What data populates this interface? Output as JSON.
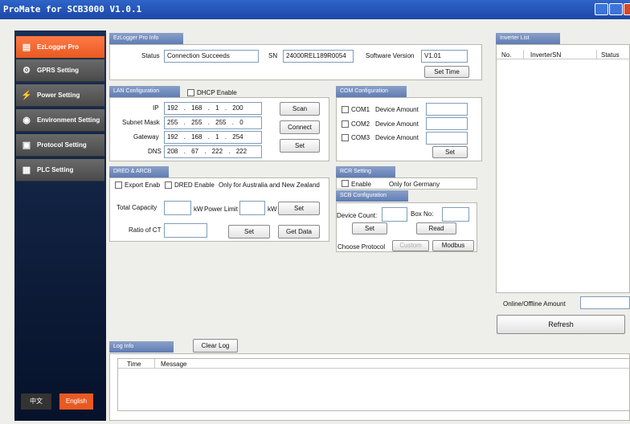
{
  "window": {
    "title": "ProMate for SCB3000 V1.0.1"
  },
  "sidebar": {
    "items": [
      {
        "label": "EzLogger Pro",
        "icon": "doc-box-icon"
      },
      {
        "label": "GPRS Setting",
        "icon": "gear-icon"
      },
      {
        "label": "Power Setting",
        "icon": "plug-icon"
      },
      {
        "label": "Environment Setting",
        "icon": "globe-icon"
      },
      {
        "label": "Protocol Setting",
        "icon": "file-icon"
      },
      {
        "label": "PLC Setting",
        "icon": "chip-icon"
      }
    ],
    "lang_cn": "中文",
    "lang_en": "English"
  },
  "info": {
    "tab": "EzLogger Pro Info",
    "status_label": "Status",
    "status_value": "Connection Succeeds",
    "sn_label": "SN",
    "sn_value": "24000REL189R0054",
    "sw_label": "Software Version",
    "sw_value": "V1.01",
    "set_time": "Set Time"
  },
  "lan": {
    "tab": "LAN Configuration",
    "dhcp": "DHCP Enable",
    "ip_label": "IP",
    "ip": [
      "192",
      "168",
      "1",
      "200"
    ],
    "mask_label": "Subnet Mask",
    "mask": [
      "255",
      "255",
      "255",
      "0"
    ],
    "gw_label": "Gateway",
    "gw": [
      "192",
      "168",
      "1",
      "254"
    ],
    "dns_label": "DNS",
    "dns": [
      "208",
      "67",
      "222",
      "222"
    ],
    "scan": "Scan",
    "connect": "Connect",
    "set": "Set"
  },
  "com": {
    "tab": "COM Configuration",
    "rows": [
      {
        "port": "COM1",
        "label": "Device Amount"
      },
      {
        "port": "COM2",
        "label": "Device Amount"
      },
      {
        "port": "COM3",
        "label": "Device Amount"
      }
    ],
    "set": "Set"
  },
  "dred": {
    "tab": "DRED & ARCB",
    "export": "Export Enab",
    "dred_enable": "DRED Enable",
    "note": "Only for Australia and New Zealand",
    "total_cap": "Total Capacity",
    "kw1": "kW",
    "power_limit": "Power Limit",
    "kw2": "kW",
    "set1": "Set",
    "ratio": "Ratio of CT",
    "set2": "Set",
    "get_data": "Get Data"
  },
  "rcr": {
    "tab": "RCR Setting",
    "enable": "Enable",
    "note": "Only for Germany"
  },
  "scb": {
    "tab": "SCB Configuration",
    "device_count": "Device Count:",
    "box_no": "Box No:",
    "set": "Set",
    "read": "Read",
    "choose_protocol": "Choose Protocol",
    "custom": "Custom",
    "modbus": "Modbus"
  },
  "inverter": {
    "tab": "Inverter List",
    "cols": [
      "No.",
      "InverterSN",
      "Status"
    ],
    "online_label": "Online/Offline Amount",
    "refresh": "Refresh"
  },
  "log": {
    "tab": "Log Info",
    "clear": "Clear Log",
    "cols": [
      "Time",
      "Message"
    ]
  }
}
